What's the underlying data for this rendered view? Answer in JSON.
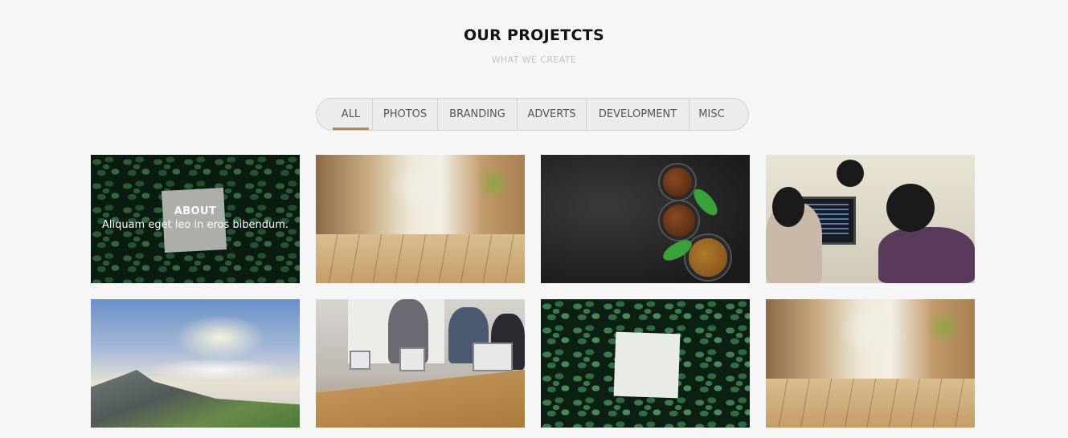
{
  "section": {
    "title": "OUR PROJETCTS",
    "subtitle": "WHAT WE CREATE"
  },
  "filters": [
    {
      "label": "ALL",
      "active": true
    },
    {
      "label": "PHOTOS",
      "active": false
    },
    {
      "label": "BRANDING",
      "active": false
    },
    {
      "label": "ADVERTS",
      "active": false
    },
    {
      "label": "DEVELOPMENT",
      "active": false
    },
    {
      "label": "MISC",
      "active": false
    }
  ],
  "colors": {
    "accent": "#b0894e",
    "background": "#f6f6f6",
    "title": "#111111",
    "subtitle": "#c4c4c4"
  },
  "projects": [
    {
      "image": "leaves-with-paper",
      "overlay_title": "ABOUT",
      "overlay_text": "Aliquam eget leo in eros bibendum."
    },
    {
      "image": "blurred-cafe-wood-floor"
    },
    {
      "image": "coffee-beans-bowls"
    },
    {
      "image": "office-coders-monitor"
    },
    {
      "image": "mountain-sunrise-clouds"
    },
    {
      "image": "team-meeting-laptops"
    },
    {
      "image": "leaves-with-paper"
    },
    {
      "image": "blurred-cafe-wood-floor"
    }
  ]
}
